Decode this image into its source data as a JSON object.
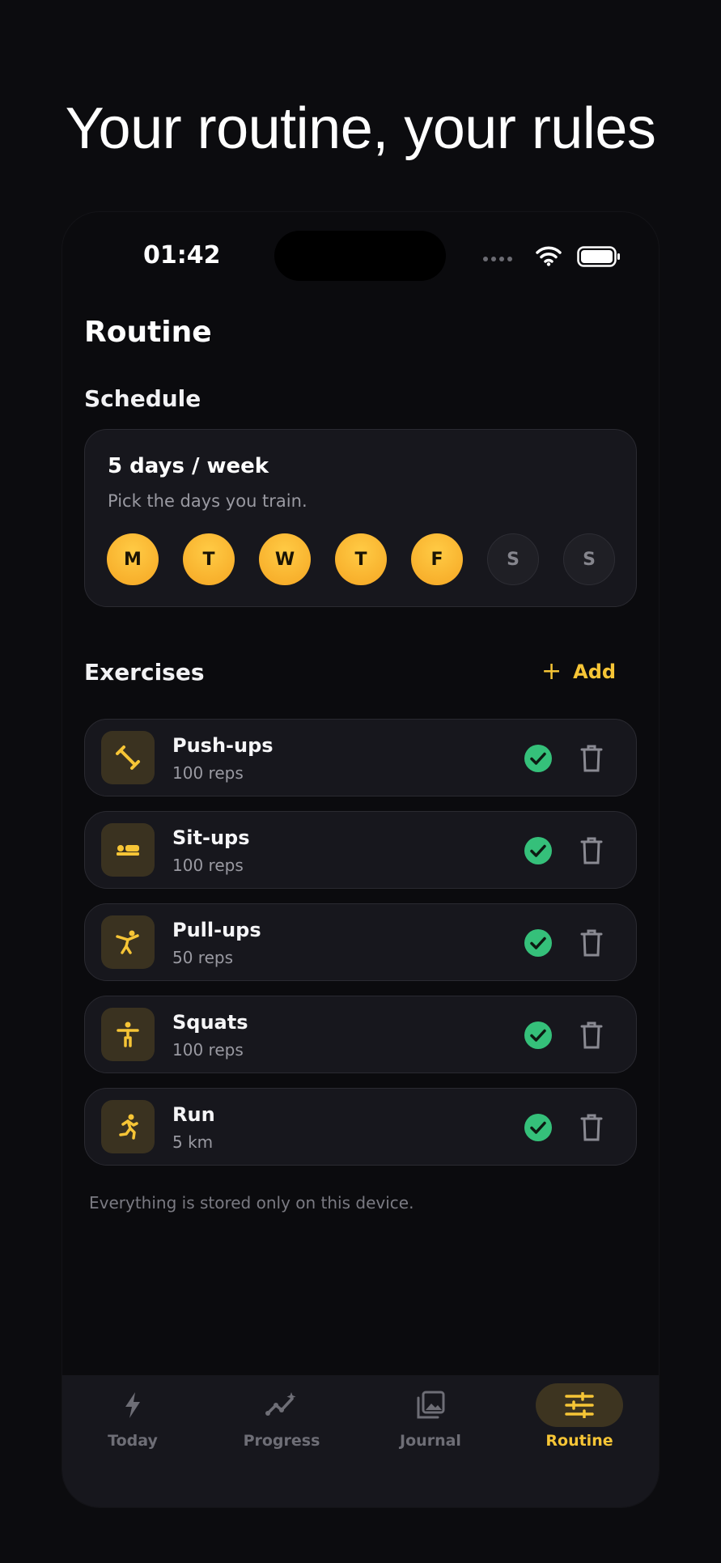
{
  "headline": "Your routine, your rules",
  "status": {
    "time": "01:42"
  },
  "page_title": "Routine",
  "schedule": {
    "section_title": "Schedule",
    "card_title": "5 days / week",
    "card_subtitle": "Pick the days you train.",
    "days": [
      {
        "label": "M",
        "selected": true
      },
      {
        "label": "T",
        "selected": true
      },
      {
        "label": "W",
        "selected": true
      },
      {
        "label": "T",
        "selected": true
      },
      {
        "label": "F",
        "selected": true
      },
      {
        "label": "S",
        "selected": false
      },
      {
        "label": "S",
        "selected": false
      }
    ]
  },
  "exercises": {
    "section_title": "Exercises",
    "add_label": "Add",
    "items": [
      {
        "name": "Push-ups",
        "amount": "100 reps",
        "icon": "dumbbell-icon"
      },
      {
        "name": "Sit-ups",
        "amount": "100 reps",
        "icon": "bed-icon"
      },
      {
        "name": "Pull-ups",
        "amount": "50 reps",
        "icon": "martial-arts-icon"
      },
      {
        "name": "Squats",
        "amount": "100 reps",
        "icon": "person-icon"
      },
      {
        "name": "Run",
        "amount": "5 km",
        "icon": "running-icon"
      }
    ]
  },
  "footnote": "Everything is stored only on this device.",
  "tabs": [
    {
      "label": "Today",
      "icon": "bolt-icon",
      "active": false
    },
    {
      "label": "Progress",
      "icon": "trend-icon",
      "active": false
    },
    {
      "label": "Journal",
      "icon": "photos-icon",
      "active": false
    },
    {
      "label": "Routine",
      "icon": "sliders-icon",
      "active": true
    }
  ],
  "colors": {
    "accent": "#f6c536",
    "check": "#35c07a",
    "card": "#17171d",
    "background": "#0c0c0f"
  }
}
